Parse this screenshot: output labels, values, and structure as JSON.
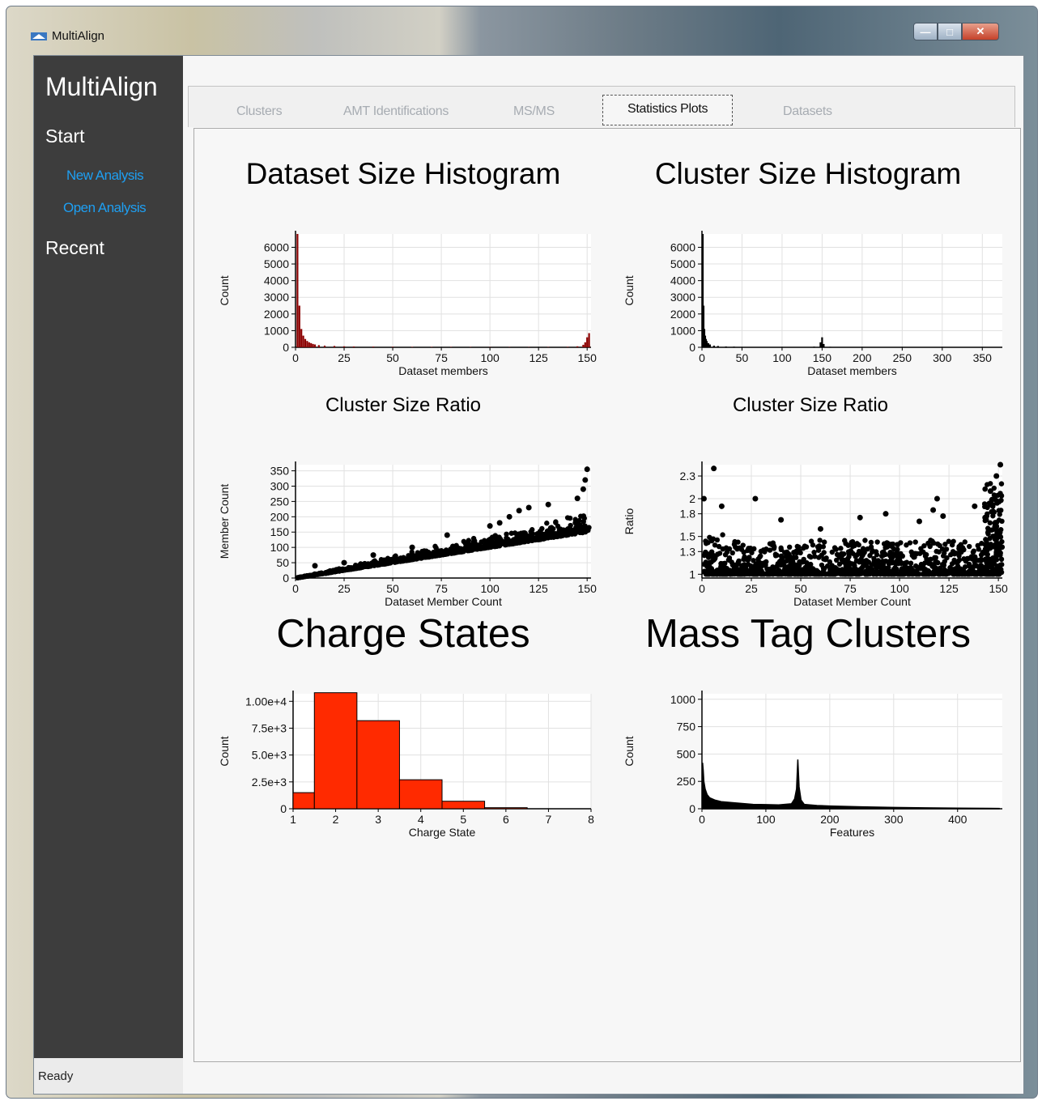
{
  "window": {
    "title": "MultiAlign"
  },
  "window_controls": {
    "minimize": "—",
    "maximize": "□",
    "close": "✕"
  },
  "sidebar": {
    "brand": "MultiAlign",
    "start_heading": "Start",
    "links": [
      "New Analysis",
      "Open Analysis"
    ],
    "recent_heading": "Recent"
  },
  "status": "Ready",
  "tabs": [
    "Clusters",
    "AMT Identifications",
    "MS/MS",
    "Statistics Plots",
    "Datasets"
  ],
  "active_tab": "Statistics Plots",
  "colors": {
    "sidebar": "#3d3d3d",
    "link": "#1e9ff2",
    "dataset_hist": "#8b0000",
    "charge_bars": "#ff2a00",
    "points": "#000000"
  },
  "chart_data": [
    {
      "type": "bar",
      "title": "Dataset Size Histogram",
      "xlabel": "Dataset members",
      "ylabel": "Count",
      "xticks": [
        "0",
        "25",
        "50",
        "75",
        "100",
        "125",
        "150"
      ],
      "yticks": [
        "0",
        "1000",
        "2000",
        "3000",
        "4000",
        "5000",
        "6000"
      ],
      "xlim": [
        0,
        152
      ],
      "ylim": [
        0,
        6800
      ],
      "x": [
        1,
        2,
        3,
        4,
        5,
        6,
        7,
        8,
        9,
        10,
        12,
        15,
        20,
        25,
        30,
        40,
        50,
        60,
        70,
        80,
        90,
        100,
        110,
        120,
        130,
        140,
        145,
        148,
        149,
        150,
        151
      ],
      "values": [
        6800,
        2500,
        1100,
        700,
        500,
        380,
        300,
        250,
        200,
        170,
        130,
        100,
        80,
        60,
        50,
        40,
        30,
        25,
        22,
        20,
        18,
        18,
        16,
        16,
        20,
        30,
        60,
        150,
        300,
        600,
        850
      ]
    },
    {
      "type": "bar",
      "title": "Cluster Size Histogram",
      "xlabel": "Dataset members",
      "ylabel": "Count",
      "xticks": [
        "0",
        "50",
        "100",
        "150",
        "200",
        "250",
        "300",
        "350"
      ],
      "yticks": [
        "0",
        "1000",
        "2000",
        "3000",
        "4000",
        "5000",
        "6000"
      ],
      "xlim": [
        0,
        375
      ],
      "ylim": [
        0,
        6800
      ],
      "x": [
        1,
        2,
        3,
        4,
        5,
        6,
        8,
        10,
        15,
        20,
        30,
        40,
        60,
        80,
        100,
        120,
        140,
        148,
        150,
        152,
        160,
        180,
        200,
        250,
        300,
        350,
        370
      ],
      "values": [
        6800,
        2500,
        1100,
        700,
        500,
        380,
        250,
        170,
        100,
        80,
        50,
        40,
        25,
        20,
        18,
        16,
        40,
        300,
        600,
        200,
        30,
        18,
        15,
        10,
        8,
        5,
        4
      ]
    },
    {
      "type": "scatter",
      "title": "Cluster Size Ratio",
      "xlabel": "Dataset Member Count",
      "ylabel": "Member Count",
      "xticks": [
        "0",
        "25",
        "50",
        "75",
        "100",
        "125",
        "150"
      ],
      "yticks": [
        "0",
        "50",
        "100",
        "150",
        "200",
        "250",
        "300",
        "350"
      ],
      "xlim": [
        0,
        152
      ],
      "ylim": [
        0,
        370
      ],
      "trend": {
        "lower_slope": 1.0,
        "upper_slope": 1.45
      },
      "outliers": [
        [
          10,
          40
        ],
        [
          25,
          50
        ],
        [
          40,
          75
        ],
        [
          60,
          100
        ],
        [
          78,
          140
        ],
        [
          100,
          170
        ],
        [
          105,
          180
        ],
        [
          110,
          200
        ],
        [
          115,
          220
        ],
        [
          120,
          230
        ],
        [
          130,
          240
        ],
        [
          145,
          260
        ],
        [
          148,
          290
        ],
        [
          149,
          320
        ],
        [
          150,
          355
        ]
      ]
    },
    {
      "type": "scatter",
      "title": "Cluster Size Ratio",
      "xlabel": "Dataset Member Count",
      "ylabel": "Ratio",
      "xticks": [
        "0",
        "25",
        "50",
        "75",
        "100",
        "125",
        "150"
      ],
      "yticks": [
        "1",
        "1.3",
        "1.5",
        "1.8",
        "2",
        "2.3"
      ],
      "xlim": [
        0,
        152
      ],
      "ylim": [
        0.95,
        2.45
      ],
      "outliers": [
        [
          1,
          2.0
        ],
        [
          6,
          2.4
        ],
        [
          10,
          1.9
        ],
        [
          27,
          2.0
        ],
        [
          40,
          1.72
        ],
        [
          60,
          1.6
        ],
        [
          80,
          1.75
        ],
        [
          93,
          1.8
        ],
        [
          110,
          1.7
        ],
        [
          117,
          1.85
        ],
        [
          119,
          2.0
        ],
        [
          122,
          1.77
        ],
        [
          138,
          1.9
        ],
        [
          146,
          2.1
        ],
        [
          149,
          2.3
        ],
        [
          151,
          2.45
        ]
      ]
    },
    {
      "type": "bar",
      "title": "Charge States",
      "xlabel": "Charge State",
      "ylabel": "Count",
      "xticks": [
        "1",
        "2",
        "3",
        "4",
        "5",
        "6",
        "7",
        "8"
      ],
      "yticks": [
        "0",
        "2.5e+3",
        "5.0e+3",
        "7.5e+3",
        "1.00e+4"
      ],
      "xlim": [
        1,
        8
      ],
      "ylim": [
        0,
        10700
      ],
      "categories": [
        "1",
        "2",
        "3",
        "4",
        "5",
        "6"
      ],
      "values": [
        1500,
        10800,
        8200,
        2700,
        700,
        100
      ]
    },
    {
      "type": "bar",
      "title": "Mass Tag Clusters",
      "xlabel": "Features",
      "ylabel": "Count",
      "xticks": [
        "0",
        "100",
        "200",
        "300",
        "400"
      ],
      "yticks": [
        "0",
        "250",
        "500",
        "750",
        "1000"
      ],
      "xlim": [
        0,
        470
      ],
      "ylim": [
        0,
        1050
      ],
      "x": [
        1,
        2,
        3,
        5,
        8,
        12,
        20,
        30,
        50,
        80,
        100,
        120,
        140,
        145,
        148,
        150,
        152,
        155,
        160,
        180,
        200,
        250,
        300,
        350,
        400,
        450,
        465
      ],
      "values": [
        420,
        350,
        250,
        180,
        130,
        100,
        80,
        65,
        55,
        40,
        38,
        35,
        45,
        90,
        180,
        450,
        200,
        80,
        40,
        30,
        25,
        18,
        12,
        8,
        6,
        4,
        3
      ]
    }
  ]
}
